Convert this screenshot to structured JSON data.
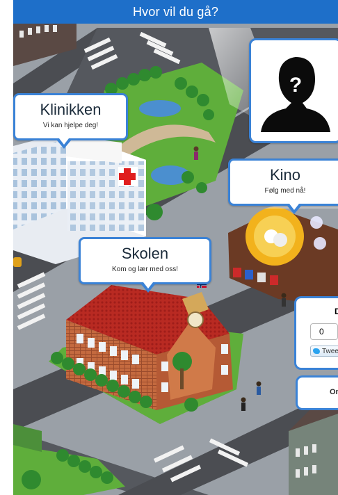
{
  "header": {
    "title": "Hvor vil du gå?"
  },
  "locations": [
    {
      "id": "klinikken",
      "title": "Klinikken",
      "subtitle": "Vi kan hjelpe deg!"
    },
    {
      "id": "kino",
      "title": "Kino",
      "subtitle": "Følg med nå!"
    },
    {
      "id": "skolen",
      "title": "Skolen",
      "subtitle": "Kom og lær med oss!"
    }
  ],
  "mystery_card": {
    "icon": "mystery-person-icon",
    "glyph": "?"
  },
  "share_panel": {
    "heading_partial": "D",
    "count": "0",
    "tweet_label": "Tweet"
  },
  "about_tab": {
    "label_partial": "Om"
  },
  "colors": {
    "accent": "#1e6fc9",
    "bubble_border": "#3a82d6",
    "grass": "#5fae3b",
    "road": "#4b4d52",
    "school_brick": "#c0623c",
    "school_roof": "#b8221f"
  }
}
